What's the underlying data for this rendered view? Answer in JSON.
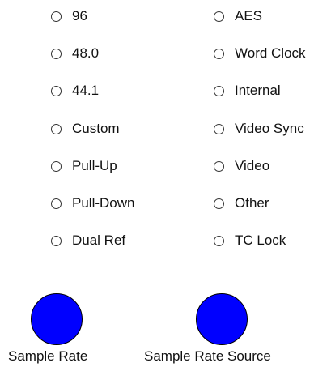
{
  "sample_rate": {
    "label": "Sample Rate",
    "options": [
      "96",
      "48.0",
      "44.1",
      "Custom",
      "Pull-Up",
      "Pull-Down",
      "Dual Ref"
    ]
  },
  "sample_rate_source": {
    "label": "Sample Rate Source",
    "options": [
      "AES",
      "Word Clock",
      "Internal",
      "Video Sync",
      "Video",
      "Other",
      "TC Lock"
    ]
  },
  "colors": {
    "knob_fill": "#0000ff",
    "knob_border": "#000000",
    "radio_border": "#333333"
  }
}
